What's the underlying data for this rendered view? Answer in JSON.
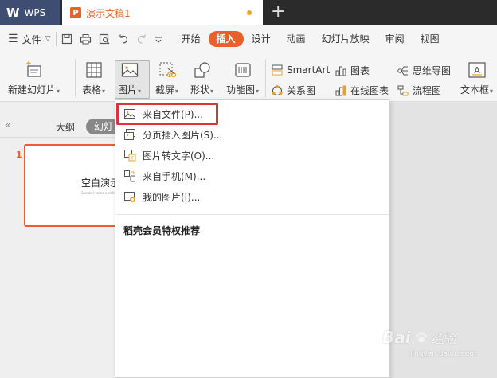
{
  "titlebar": {
    "app_name": "WPS",
    "doc_title": "演示文稿1"
  },
  "menubar": {
    "file_label": "文件",
    "items": [
      "开始",
      "插入",
      "设计",
      "动画",
      "幻灯片放映",
      "审阅",
      "视图"
    ],
    "active": "插入"
  },
  "ribbon": {
    "new_slide": "新建幻灯片",
    "table": "表格",
    "picture": "图片",
    "screenshot": "截屏",
    "shape": "形状",
    "function_chart": "功能图",
    "smartart": "SmartArt",
    "relation": "关系图",
    "chart": "图表",
    "online_chart": "在线图表",
    "mindmap": "思维导图",
    "flowchart": "流程图",
    "textbox": "文本框"
  },
  "leftpane": {
    "collapse_glyph": "«",
    "tab_outline": "大纲",
    "tab_slides": "幻灯",
    "slide_number": "1",
    "thumb_title": "空白演示",
    "thumb_subtitle": "Speaker name and title here"
  },
  "dropdown": {
    "items": [
      "来自文件(P)...",
      "分页插入图片(S)...",
      "图片转文字(O)...",
      "来自手机(M)...",
      "我的图片(I)..."
    ],
    "section_title": "稻壳会员特权推荐"
  },
  "watermark": {
    "brand": "Bai",
    "brand_suffix": "经验",
    "url": "jingyan.baidu.com"
  },
  "colors": {
    "accent": "#e8602c",
    "highlight_border": "#e0303a",
    "wps_tab": "#3e4e73"
  }
}
